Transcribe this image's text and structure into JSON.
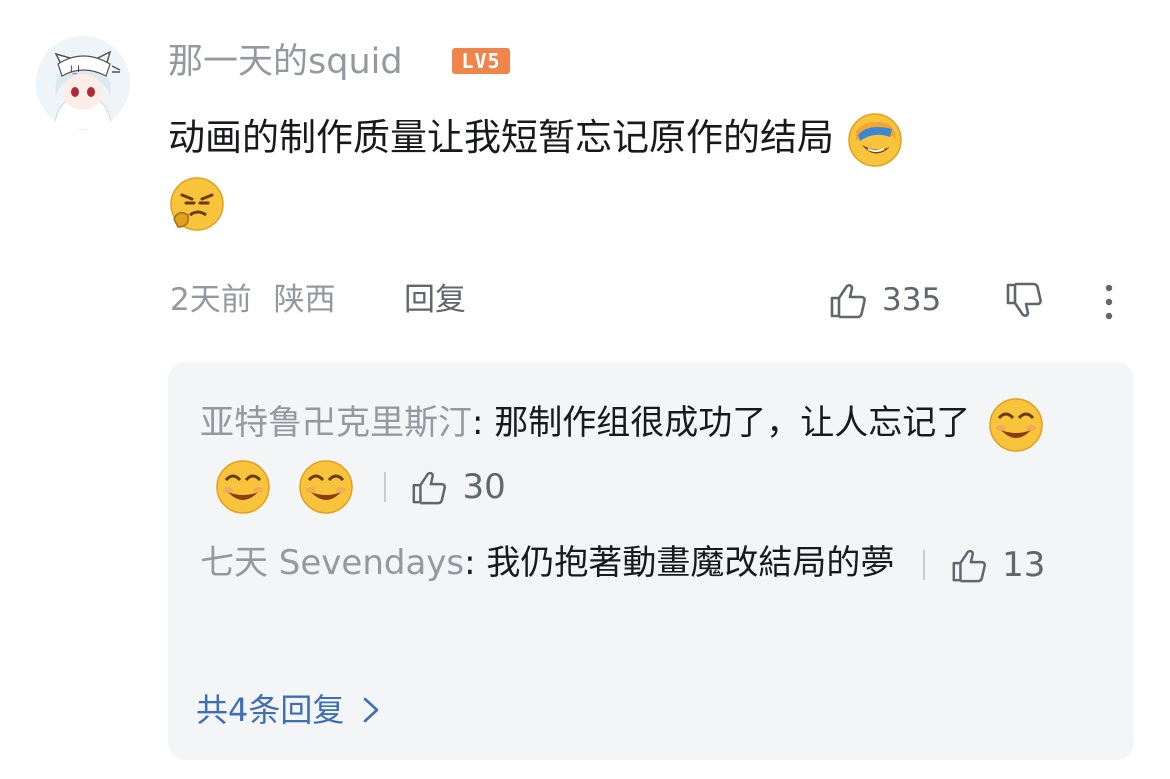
{
  "comment": {
    "username": "那一天的squid",
    "level": "LV5",
    "text": "动画的制作质量让我短暂忘记原作的结局",
    "emojis": [
      "crying-laughing-emoji",
      "sneer-emoji"
    ],
    "time": "2天前",
    "location": "陕西",
    "reply_label": "回复",
    "likes": "335"
  },
  "replies": [
    {
      "name": "亚特鲁卍克里斯汀",
      "separator": ":",
      "text": " 那制作组很成功了，让人忘记了",
      "emojis": [
        "grinning-emoji",
        "grinning-emoji",
        "grinning-emoji"
      ],
      "likes": "30"
    },
    {
      "name": "七天 Sevendays",
      "separator": ":",
      "text": " 我仍抱著動畫魔改結局的夢",
      "likes": "13"
    }
  ],
  "more_replies_label": "共4条回复",
  "colors": {
    "secondary_text": "#9499a0",
    "link_blue": "#3d6fb6",
    "level_badge": "#f0854c",
    "reply_bg": "#f4f5f7"
  }
}
